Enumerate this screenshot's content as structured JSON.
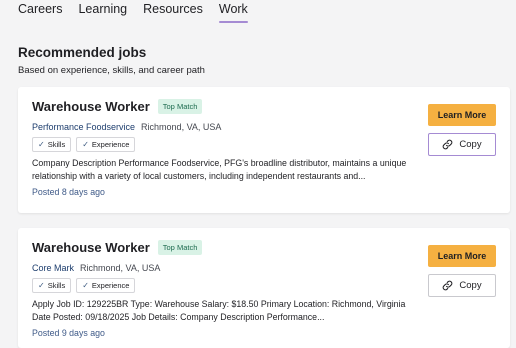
{
  "tabs": [
    {
      "label": "Careers"
    },
    {
      "label": "Learning"
    },
    {
      "label": "Resources"
    },
    {
      "label": "Work",
      "active": true
    }
  ],
  "section": {
    "title": "Recommended jobs",
    "subtitle": "Based on experience, skills, and career path"
  },
  "jobs": [
    {
      "title": "Warehouse Worker",
      "badge": "Top Match",
      "company": "Performance Foodservice",
      "location": "Richmond, VA, USA",
      "chips": [
        "Skills",
        "Experience"
      ],
      "description": "Company Description Performance Foodservice, PFG's broadline distributor, maintains a unique relationship with a variety of local customers, including independent restaurants and...",
      "posted": "Posted 8 days ago",
      "learn_more": "Learn More",
      "copy": "Copy"
    },
    {
      "title": "Warehouse Worker",
      "badge": "Top Match",
      "company": "Core Mark",
      "location": "Richmond, VA, USA",
      "chips": [
        "Skills",
        "Experience"
      ],
      "description": "Apply Job ID: 129225BR Type: Warehouse Salary: $18.50 Primary Location: Richmond, Virginia Date Posted: 09/18/2025 Job Details: Company Description Performance...",
      "posted": "Posted 9 days ago",
      "learn_more": "Learn More",
      "copy": "Copy"
    }
  ],
  "colors": {
    "accent_orange": "#f5b041",
    "accent_purple": "#a58bd3",
    "badge_bg": "#d9f2e6",
    "badge_text": "#1d6b4f",
    "company_link": "#1e3e6e"
  },
  "icons": {
    "chip_check": "check-icon",
    "copy_button": "link-icon"
  }
}
